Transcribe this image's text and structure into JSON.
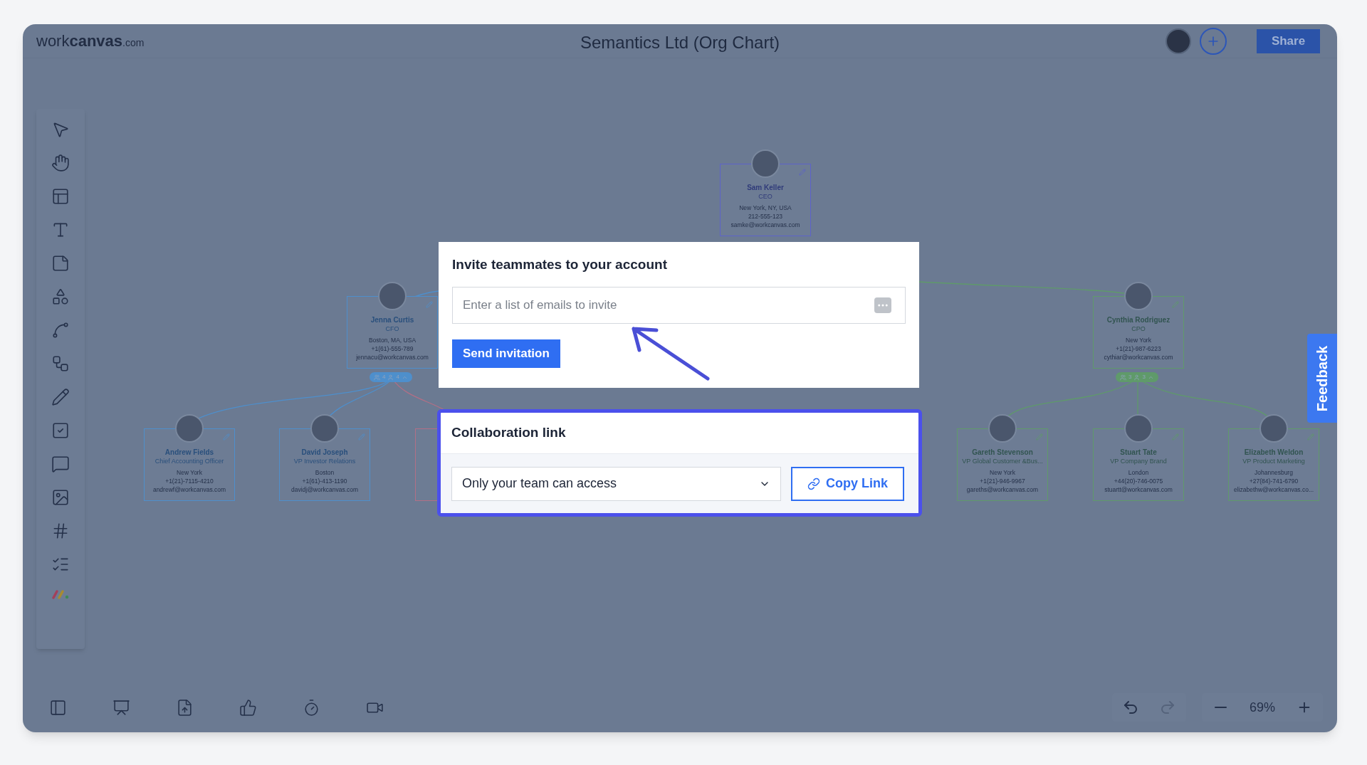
{
  "header": {
    "logo": {
      "plain": "work",
      "bold": "canvas",
      "suffix": ".com"
    },
    "title": "Semantics Ltd (Org Chart)",
    "share_button": "Share"
  },
  "org_chart": {
    "nodes": [
      {
        "name": "Sam Keller",
        "title": "CEO",
        "location": "New York, NY, USA",
        "phone": "212-555-123",
        "email": "samke@workcanvas.com",
        "color": "#5d63c9"
      },
      {
        "name": "Jenna Curtis",
        "title": "CFO",
        "location": "Boston, MA, USA",
        "phone": "+1(61)-555-789",
        "email": "jennacu@workcanvas.com",
        "color": "#4e8fcc",
        "badge": {
          "teams": "4",
          "people": "4"
        }
      },
      {
        "name": "Cynthia Rodriguez",
        "title": "CPO",
        "location": "New York",
        "phone": "+1(21)-987-6223",
        "email": "cythiar@workcanvas.com",
        "color": "#5f9a6a",
        "badge": {
          "teams": "3",
          "people": "3"
        }
      },
      {
        "name": "Andrew Fields",
        "title": "Chief Accounting Officer",
        "location": "New York",
        "phone": "+1(21)-7115-4210",
        "email": "andrewf@workcanvas.com",
        "color": "#4e8fcc"
      },
      {
        "name": "David Joseph",
        "title": "VP Investor Relations",
        "location": "Boston",
        "phone": "+1(61)-413-1190",
        "email": "davidj@workcanvas.com",
        "color": "#4e8fcc"
      },
      {
        "color": "#b26f86"
      },
      {
        "name": "Gareth Stevenson",
        "title": "VP Global Customer &Bus...",
        "location": "New York",
        "phone": "+1(21)-946-9967",
        "email": "gareths@workcanvas.com",
        "color": "#5f9a6a"
      },
      {
        "name": "Stuart Tate",
        "title": "VP Company Brand",
        "location": "London",
        "phone": "+44(20)-746-0075",
        "email": "stuartt@workcanvas.com",
        "color": "#5f9a6a"
      },
      {
        "name": "Elizabeth Weldon",
        "title": "VP Product Marketing",
        "location": "Johannesburg",
        "phone": "+27(84)-741-6790",
        "email": "elizabethw@workcanvas.co...",
        "color": "#5f9a6a"
      }
    ]
  },
  "invite_dialog": {
    "title": "Invite teammates to your account",
    "email_field": {
      "placeholder": "Enter a list of emails to invite"
    },
    "send_button": "Send invitation"
  },
  "link_dialog": {
    "title": "Collaboration link",
    "access_select": {
      "value": "Only your team can access"
    },
    "copy_button": "Copy Link"
  },
  "zoom": {
    "value": "69%"
  },
  "feedback_tab": "Feedback"
}
